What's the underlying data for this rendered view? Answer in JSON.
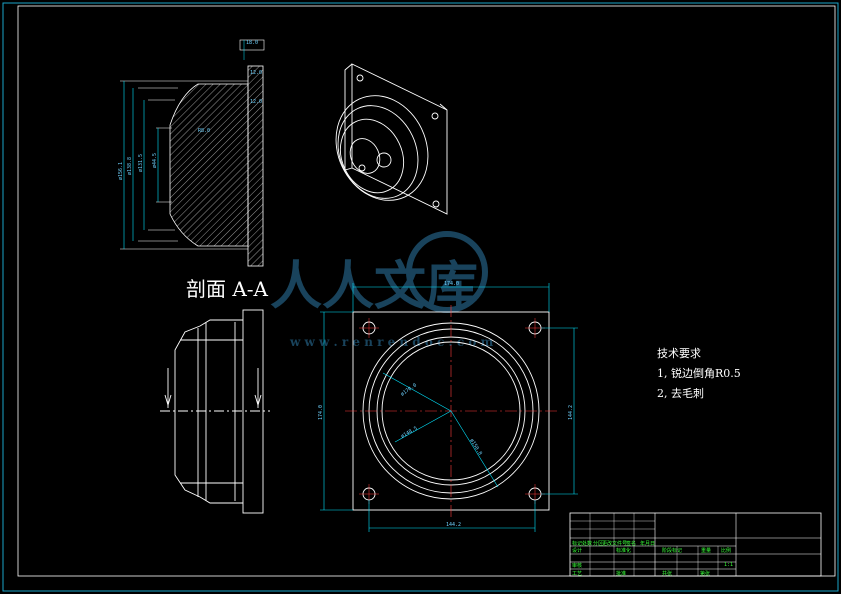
{
  "section_label": "剖面 A-A",
  "tech_requirements": {
    "heading": "技术要求",
    "items": [
      "1, 锐边倒角R0.5",
      "2, 去毛刺"
    ]
  },
  "watermark": {
    "brand": "人人文库",
    "url": "w w w . r e n r e n d o c . c o m"
  },
  "dimensions": {
    "top_width": "174.0",
    "bottom_width": "144.2",
    "left_height": "174.0",
    "right_height": "144.2",
    "dia_large": "ø170.0",
    "dia_mid": "ø148.5",
    "dia_small": "ø150.8",
    "flange_t": "18.0",
    "step_1": "12.0",
    "step_2": "12.0",
    "sec_d1": "ø156.1",
    "sec_d2": "ø138.8",
    "sec_d3": "ø131.5",
    "sec_d4": "ø44.5",
    "sec_r": "R8.0"
  },
  "title_block": {
    "row1": [
      "标记",
      "处数",
      "分区",
      "更改文件号",
      "签名",
      "年月日"
    ],
    "row2": [
      "设计",
      "",
      "标准化",
      "",
      "阶段标记",
      "重量",
      "比例"
    ],
    "row3": [
      "审核",
      "",
      "",
      "",
      "",
      "",
      "1:1"
    ],
    "row4": [
      "工艺",
      "",
      "批准",
      "",
      "共张",
      "第张"
    ]
  },
  "colors": {
    "line": "#ffffff",
    "dimension": "#00e5ff",
    "title_text": "#39ff39",
    "watermark": "#1c4b66"
  }
}
